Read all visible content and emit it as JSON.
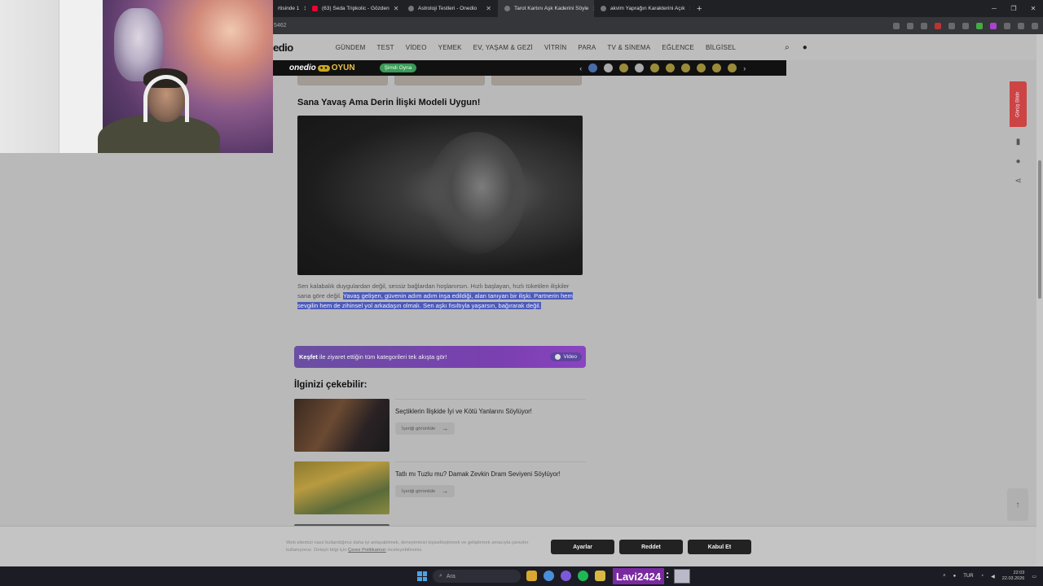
{
  "browser": {
    "tabs": [
      {
        "label": "rtisinde 1",
        "active": false
      },
      {
        "label": "(63) Seda Tripkolic - Gözden",
        "active": false,
        "icon": "youtube-icon"
      },
      {
        "label": "Astroloji Testleri - Onedio",
        "active": false
      },
      {
        "label": "Tarot Kartını Aşk Kaderini Söyle",
        "active": true
      },
      {
        "label": "akvim Yaprağın Karakterini Açık",
        "active": false
      }
    ],
    "url_fragment": "5462"
  },
  "site": {
    "logo": "edio",
    "nav": [
      "GÜNDEM",
      "TEST",
      "VİDEO",
      "YEMEK",
      "EV, YAŞAM & GEZİ",
      "VİTRİN",
      "PARA",
      "TV & SİNEMA",
      "EĞLENCE",
      "BİLGİSEL"
    ]
  },
  "gamebar": {
    "logo": "onedio",
    "badge": "● ●",
    "title": "OYUN",
    "play_label": "Şimdi Oyna"
  },
  "article": {
    "section_title": "Sana Yavaş Ama Derin İlişki Modeli Uygun!",
    "desc_plain": "Sen kalabalık duygulardan değil, sessiz bağlardan hoşlanırsın. Hızlı başlayan, hızlı tüketilen ilişkiler sana göre değil. ",
    "desc_highlight": "Yavaş gelişen, güvenin adım adım inşa edildiği, alan tanıyan bir ilişki. Partnerin hem sevgilin hem de zihinsel yol arkadaşın olmalı. Sen aşkı fısıltıyla yaşarsın, bağırarak değil."
  },
  "explore": {
    "bold": "Keşfet",
    "text": " ile ziyaret ettiğin tüm kategorileri tek akışta gör!",
    "video_label": "Video"
  },
  "related": {
    "title": "İlginizi çekebilir:",
    "items": [
      {
        "title": "Seçtiklerin İlişkide İyi ve Kötü Yanlarını Söylüyor!",
        "button": "İçeriği görüntüle"
      },
      {
        "title": "Tatlı mı Tuzlu mu? Damak Zevkin Dram Seviyeni Söylüyor!",
        "button": "İçeriği görüntüle"
      }
    ]
  },
  "sidebar": {
    "feedback": "Görüş Bildir"
  },
  "cookie": {
    "text": "Web sitemizi nasıl kullandığınız daha iyi anlayabilmek, deneyiminizi kişiselleştirmek ve geliştirmek amacıyla çerezler kullanıyoruz. Detaylı bilgi için ",
    "link": "Çerez Politikamızı",
    "text_end": " inceleyebilirsiniz.",
    "settings": "Ayarlar",
    "reject": "Reddet",
    "accept": "Kabul Et"
  },
  "taskbar": {
    "search": "Ara",
    "overlay_name": "Lavi2424",
    "overlay_colon": ":",
    "lang": "TUR",
    "time": "22:03",
    "date": "22.03.2026"
  }
}
